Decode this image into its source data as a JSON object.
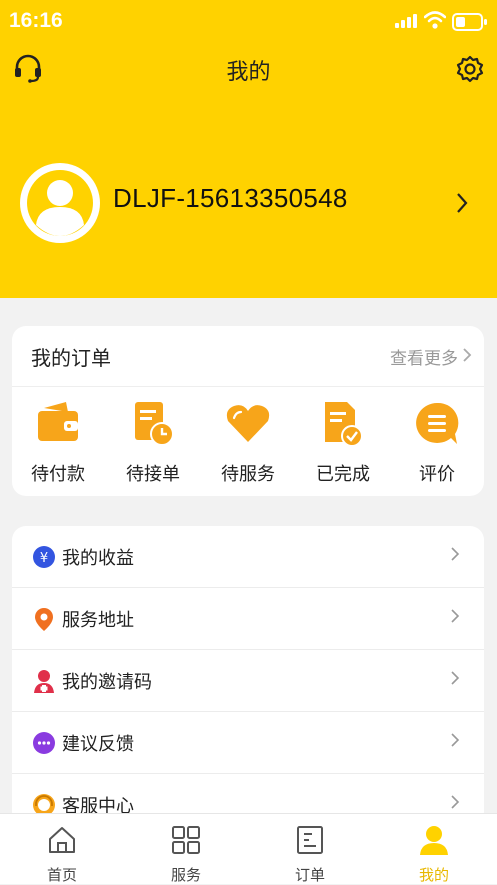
{
  "status_bar": {
    "time": "16:16"
  },
  "nav": {
    "title": "我的"
  },
  "profile": {
    "username": "DLJF-15613350548"
  },
  "orders": {
    "title": "我的订单",
    "more_label": "查看更多",
    "items": [
      {
        "label": "待付款",
        "icon": "wallet-icon"
      },
      {
        "label": "待接单",
        "icon": "clock-document-icon"
      },
      {
        "label": "待服务",
        "icon": "heart-icon"
      },
      {
        "label": "已完成",
        "icon": "check-document-icon"
      },
      {
        "label": "评价",
        "icon": "chat-bubble-icon"
      }
    ]
  },
  "menu": {
    "items": [
      {
        "label": "我的收益",
        "icon": "yen-icon"
      },
      {
        "label": "服务地址",
        "icon": "location-pin-icon"
      },
      {
        "label": "我的邀请码",
        "icon": "invite-user-icon"
      },
      {
        "label": "建议反馈",
        "icon": "feedback-icon"
      },
      {
        "label": "客服中心",
        "icon": "customer-service-icon"
      }
    ]
  },
  "tabbar": {
    "items": [
      {
        "label": "首页",
        "icon": "home-icon"
      },
      {
        "label": "服务",
        "icon": "grid-icon"
      },
      {
        "label": "订单",
        "icon": "order-list-icon"
      },
      {
        "label": "我的",
        "icon": "user-icon"
      }
    ],
    "active_index": 3
  },
  "colors": {
    "brand": "#ffd200",
    "order_icon": "#f7a51a",
    "active_tab": "#e8b800"
  }
}
